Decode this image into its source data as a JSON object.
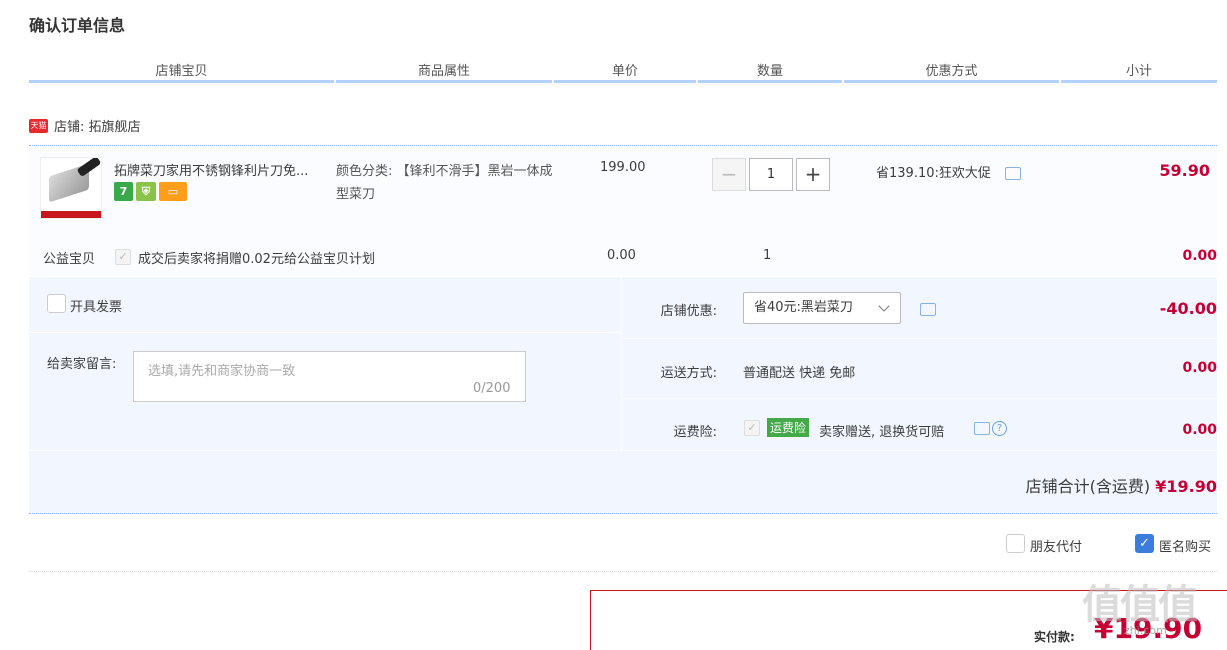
{
  "page_title": "确认订单信息",
  "columns": [
    "店铺宝贝",
    "商品属性",
    "单价",
    "数量",
    "优惠方式",
    "小计"
  ],
  "shop": {
    "badge": "天猫",
    "label": "店铺: 拓旗舰店"
  },
  "item": {
    "title": "拓牌菜刀家用不锈钢锋利片刀免...",
    "attribute": "颜色分类: 【锋利不滑手】黑岩一体成型菜刀",
    "unit_price": "199.00",
    "quantity": "1",
    "minus": "−",
    "plus": "+",
    "promotion": "省139.10:狂欢大促",
    "subtotal": "59.90",
    "badge_seven": "7"
  },
  "charity": {
    "label": "公益宝贝",
    "text": "成交后卖家将捐赠0.02元给公益宝贝计划",
    "price": "0.00",
    "quantity": "1",
    "subtotal": "0.00"
  },
  "invoice_label": "开具发票",
  "message": {
    "label": "给卖家留言:",
    "placeholder": "选填,请先和商家协商一致",
    "count": "0/200"
  },
  "shop_discount": {
    "label": "店铺优惠:",
    "value": "省40元:黑岩菜刀",
    "amount": "-40.00"
  },
  "shipping": {
    "label": "运送方式:",
    "value": "普通配送 快递 免邮",
    "amount": "0.00"
  },
  "insurance": {
    "label": "运费险:",
    "badge": "运费险",
    "text": "卖家赠送, 退换货可赔",
    "amount": "0.00"
  },
  "shop_total": {
    "label": "店铺合计(含运费)",
    "amount": "¥19.90"
  },
  "friend_pay": "朋友代付",
  "anonymous": "匿名购买",
  "payment": {
    "label": "实付款:",
    "amount": "¥19.90"
  },
  "watermark": {
    "main": "值值值",
    "url": "zhi.com"
  },
  "colors": {
    "price_red": "#c70034",
    "accent_blue": "#3b7ddd",
    "panel_bg": "#f2f7ff"
  }
}
